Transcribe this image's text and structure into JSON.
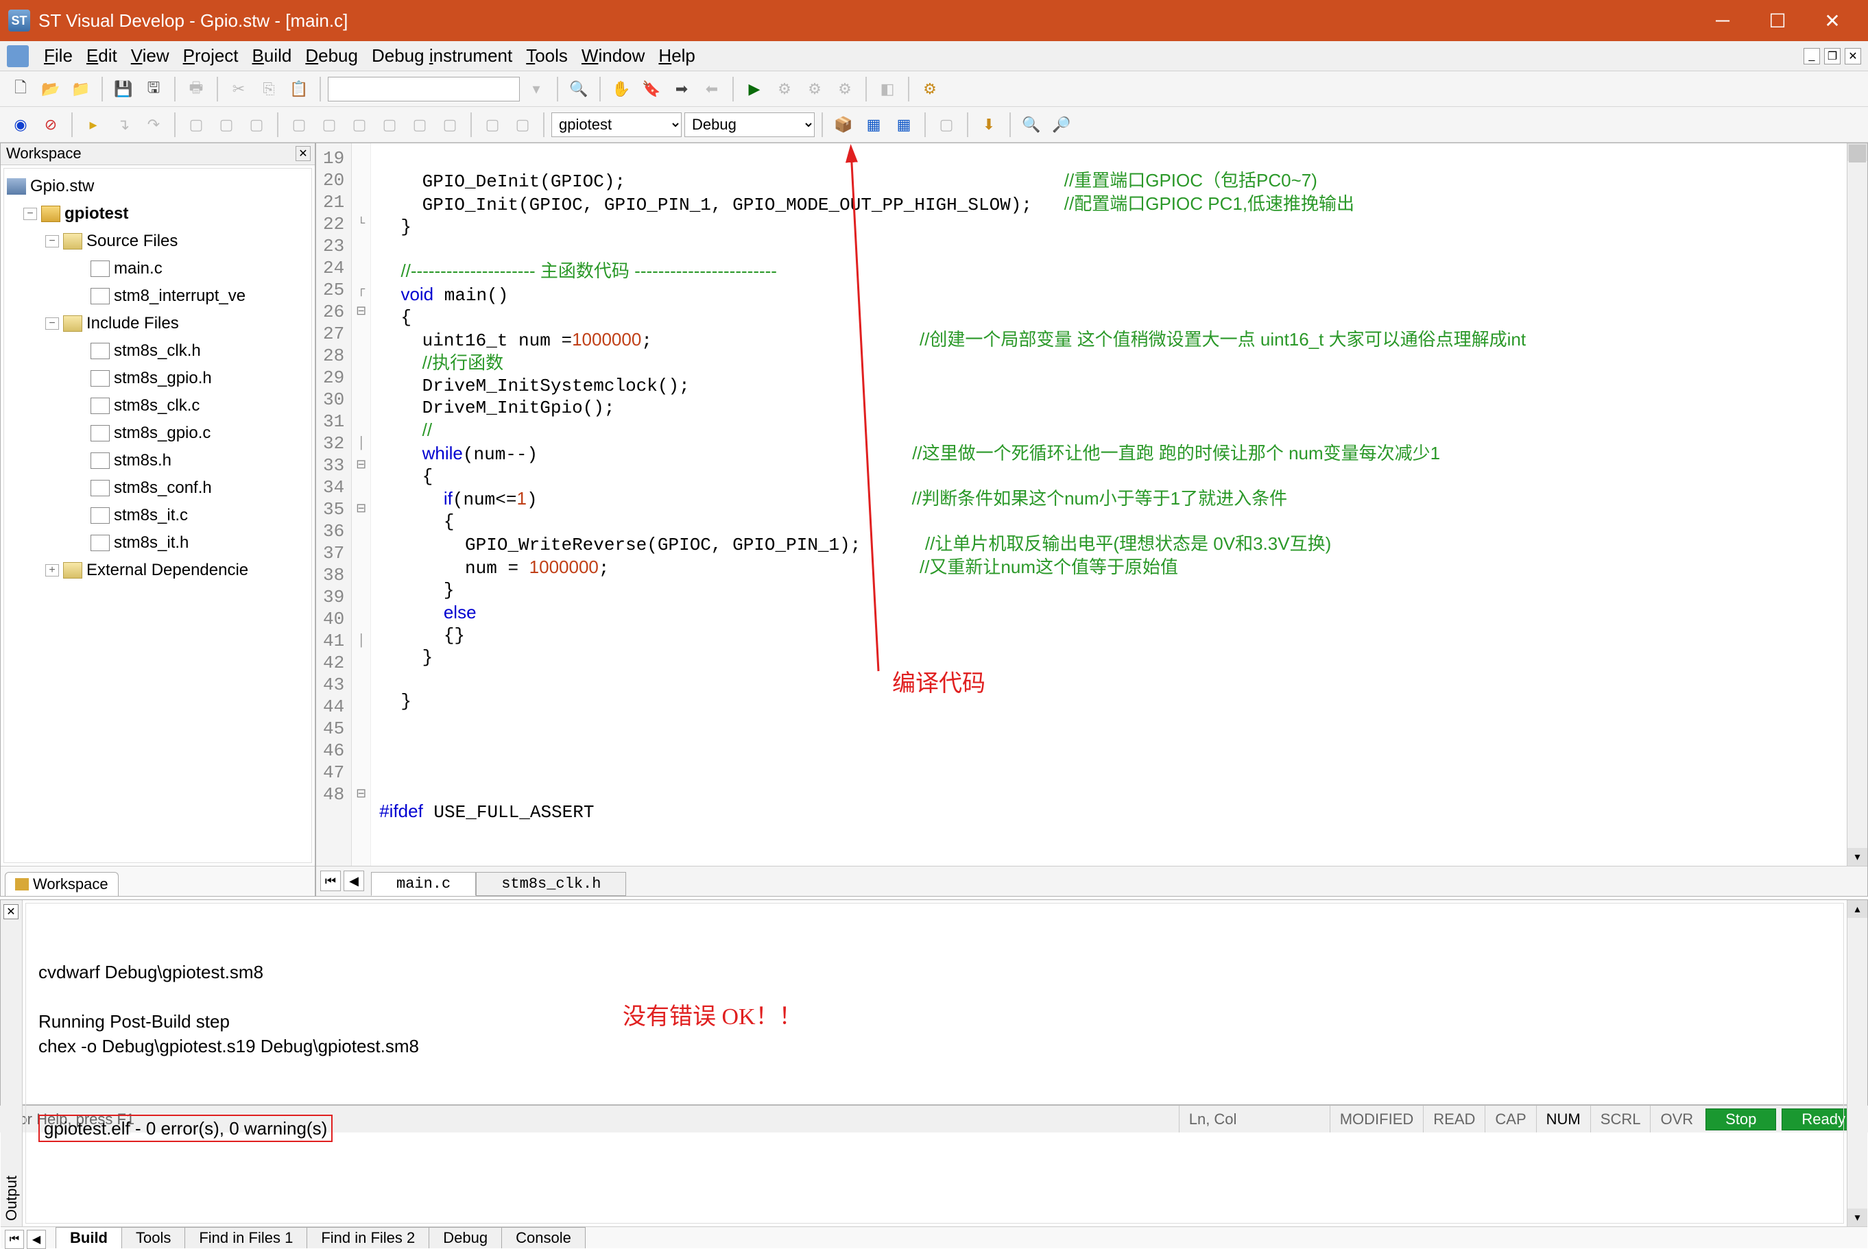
{
  "window": {
    "title": "ST Visual Develop - Gpio.stw - [main.c]"
  },
  "menu": {
    "items": [
      {
        "label": "File",
        "u": "F"
      },
      {
        "label": "Edit",
        "u": "E"
      },
      {
        "label": "View",
        "u": "V"
      },
      {
        "label": "Project",
        "u": "P"
      },
      {
        "label": "Build",
        "u": "B"
      },
      {
        "label": "Debug",
        "u": "D"
      },
      {
        "label": "Debug instrument",
        "u": "i"
      },
      {
        "label": "Tools",
        "u": "T"
      },
      {
        "label": "Window",
        "u": "W"
      },
      {
        "label": "Help",
        "u": "H"
      }
    ]
  },
  "toolbar2": {
    "target": "gpiotest",
    "config": "Debug"
  },
  "workspace": {
    "title": "Workspace",
    "root": "Gpio.stw",
    "project": "gpiotest",
    "source_folder": "Source Files",
    "sources": [
      "main.c",
      "stm8_interrupt_ve"
    ],
    "include_folder": "Include Files",
    "includes": [
      "stm8s_clk.h",
      "stm8s_gpio.h",
      "stm8s_clk.c",
      "stm8s_gpio.c",
      "stm8s.h",
      "stm8s_conf.h",
      "stm8s_it.c",
      "stm8s_it.h"
    ],
    "ext_folder": "External Dependencie",
    "tab": "Workspace"
  },
  "editor": {
    "startLine": 19,
    "tabs": [
      "main.c",
      "stm8s_clk.h"
    ],
    "activeTab": 0,
    "lines": [
      {
        "h": ""
      },
      {
        "h": "    GPIO_DeInit(GPIOC);                                         <span class='cm'>//重置端口GPIOC（包括PC0~7)</span>"
      },
      {
        "h": "    GPIO_Init(GPIOC, GPIO_PIN_1, GPIO_MODE_OUT_PP_HIGH_SLOW);   <span class='cm'>//配置端口GPIOC PC1,低速推挽输出</span>"
      },
      {
        "h": "  }"
      },
      {
        "h": ""
      },
      {
        "h": "  <span class='cm'>//--------------------- 主函数代码 ------------------------</span>"
      },
      {
        "h": "  <span class='kw'>void</span> main()"
      },
      {
        "h": "  {"
      },
      {
        "h": "    uint16_t num =<span class='num'>1000000</span>;                         <span class='cm'>//创建一个局部变量 这个值稍微设置大一点 uint16_t 大家可以通俗点理解成int</span>"
      },
      {
        "h": "    <span class='cm'>//执行函数</span>"
      },
      {
        "h": "    DriveM_InitSystemclock();"
      },
      {
        "h": "    DriveM_InitGpio();"
      },
      {
        "h": "    <span class='cm'>//</span>"
      },
      {
        "h": "    <span class='kw'>while</span>(num--)                                   <span class='cm'>//这里做一个死循环让他一直跑 跑的时候让那个 num变量每次减少1</span>"
      },
      {
        "h": "    {"
      },
      {
        "h": "      <span class='kw'>if</span>(num&lt;=<span class='num'>1</span>)                                   <span class='cm'>//判断条件如果这个num小于等于1了就进入条件</span>"
      },
      {
        "h": "      {"
      },
      {
        "h": "        GPIO_WriteReverse(GPIOC, GPIO_PIN_1);      <span class='cm'>//让单片机取反输出电平(理想状态是 0V和3.3V互换)</span>"
      },
      {
        "h": "        num = <span class='num'>1000000</span>;                             <span class='cm'>//又重新让num这个值等于原始值</span>"
      },
      {
        "h": "      }"
      },
      {
        "h": "      <span class='kw'>else</span>"
      },
      {
        "h": "      {}"
      },
      {
        "h": "    }"
      },
      {
        "h": ""
      },
      {
        "h": "  }"
      },
      {
        "h": ""
      },
      {
        "h": ""
      },
      {
        "h": ""
      },
      {
        "h": ""
      },
      {
        "h": "<span class='kw'>#ifdef</span> USE_FULL_ASSERT"
      }
    ]
  },
  "annotations": {
    "compile": "编译代码",
    "noerr": "没有错误 OK！！"
  },
  "output": {
    "side_label": "Output",
    "lines": [
      "cvdwarf Debug\\gpiotest.sm8",
      "",
      "Running Post-Build step",
      "chex -o Debug\\gpiotest.s19 Debug\\gpiotest.sm8"
    ],
    "result": "gpiotest.elf - 0 error(s), 0 warning(s)",
    "tabs": [
      "Build",
      "Tools",
      "Find in Files 1",
      "Find in Files 2",
      "Debug",
      "Console"
    ],
    "activeTab": 0
  },
  "status": {
    "help": "For Help, press F1",
    "lncol": "Ln, Col",
    "cells": [
      "MODIFIED",
      "READ",
      "CAP",
      "NUM",
      "SCRL",
      "OVR"
    ],
    "btn_stop": "Stop",
    "btn_ready": "Ready"
  }
}
